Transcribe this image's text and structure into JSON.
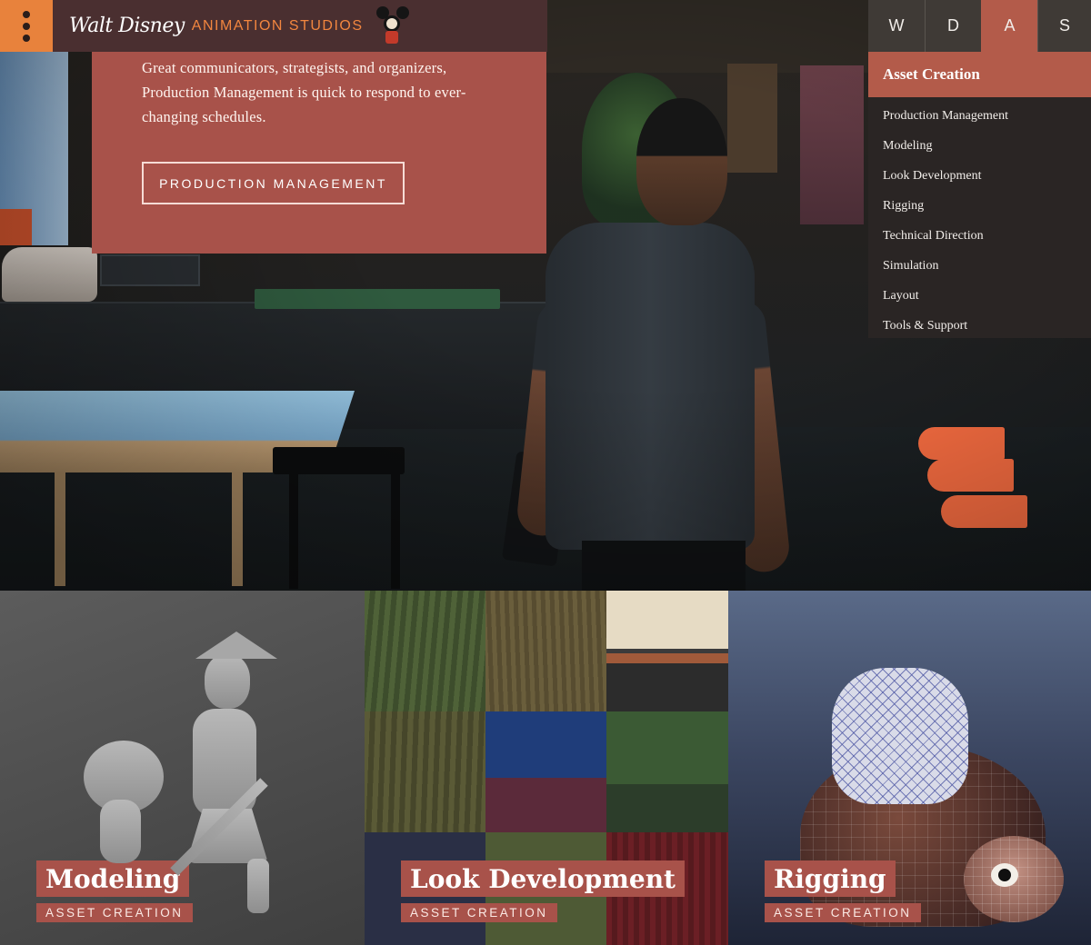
{
  "header": {
    "logo_script": "Walt Disney",
    "logo_studio": "ANIMATION STUDIOS"
  },
  "tabs": [
    {
      "label": "W",
      "active": false
    },
    {
      "label": "D",
      "active": false
    },
    {
      "label": "A",
      "active": true
    },
    {
      "label": "S",
      "active": false
    }
  ],
  "dropdown": {
    "title": "Asset Creation",
    "items": [
      "Production Management",
      "Modeling",
      "Look Development",
      "Rigging",
      "Technical Direction",
      "Simulation",
      "Layout",
      "Tools & Support"
    ]
  },
  "hero": {
    "text": "Great communicators, strategists, and organizers, Production Management is quick to respond to ever-changing schedules.",
    "button": "PRODUCTION MANAGEMENT"
  },
  "tiles": [
    {
      "title": "Modeling",
      "subtitle": "ASSET CREATION"
    },
    {
      "title": "Look Development",
      "subtitle": "ASSET CREATION"
    },
    {
      "title": "Rigging",
      "subtitle": "ASSET CREATION"
    }
  ],
  "colors": {
    "accent_orange": "#e8823c",
    "card_red": "#a8524a",
    "tab_active": "#b35b4a",
    "topbar": "#4a2f30"
  },
  "icons": {
    "menu": "vertical-dots-menu-icon",
    "logo_character": "mickey-mouse-icon"
  }
}
